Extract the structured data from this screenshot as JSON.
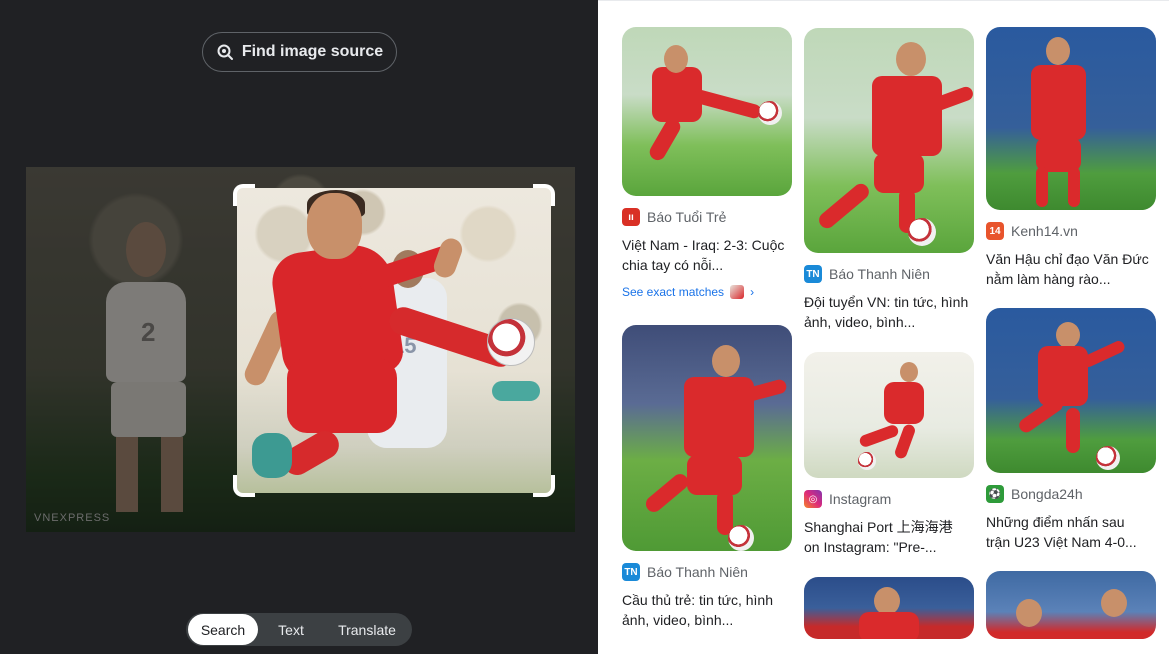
{
  "left_panel": {
    "find_source_label": "Find image source",
    "watermark": "VNEXPRESS",
    "player_number": "2",
    "crop_player_number": "15",
    "tabs": [
      {
        "label": "Search",
        "selected": true
      },
      {
        "label": "Text",
        "selected": false
      },
      {
        "label": "Translate",
        "selected": false
      }
    ]
  },
  "results": [
    {
      "source": "Báo Tuổi Trẻ",
      "title": "Việt Nam - Iraq: 2-3: Cuộc chia tay có nỗi...",
      "exact_matches": "See exact matches",
      "favicon": "tuoitre-icon",
      "favicon_color": "#d93025"
    },
    {
      "source": "Báo Thanh Niên",
      "title": "Cầu thủ trẻ: tin tức, hình ảnh, video, bình...",
      "favicon": "thanhnien-icon",
      "favicon_color": "#1a8ad8"
    },
    {
      "source": "Báo Thanh Niên",
      "title": "Đội tuyển VN: tin tức, hình ảnh, video, bình...",
      "favicon": "thanhnien-icon",
      "favicon_color": "#1a8ad8"
    },
    {
      "source": "Instagram",
      "title": "Shanghai Port 上海海港 on Instagram: \"Pre-...",
      "favicon": "instagram-icon",
      "favicon_color": "#c13584"
    },
    {
      "source": "Kenh14.vn",
      "title": "Văn Hậu chỉ đạo Văn Đức nằm làm hàng rào...",
      "favicon": "kenh14-icon",
      "favicon_color": "#e8542c"
    },
    {
      "source": "Bongda24h",
      "title": "Những điểm nhấn sau trận U23 Việt Nam 4-0...",
      "favicon": "bongda24h-icon",
      "favicon_color": "#2e9b3a"
    }
  ]
}
